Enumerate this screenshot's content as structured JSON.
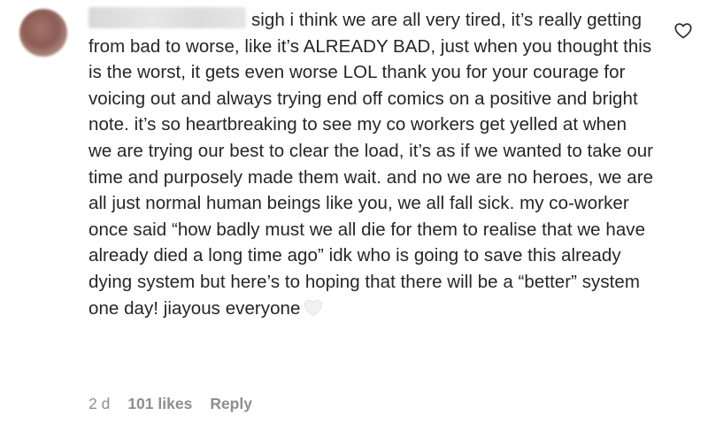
{
  "comment": {
    "text": "sigh i think we are all very tired, it’s really getting from bad to worse, like it’s ALREADY BAD, just when you thought this is the worst, it gets even worse LOL thank you for your courage for voicing out and always trying end off comics on a positive and bright note. it’s so heartbreaking to see my co workers get yelled at when we are trying our best to clear the load, it’s as if we wanted to take our time and purposely made them wait. and no we are no heroes, we are all just normal human beings like you, we all fall sick. my co-worker once said “how badly must we all die for them to realise that we have already died a long time ago” idk who is going to save this already dying system but here’s to hoping that there will be a “better” system one day! jiayous everyone",
    "emoji_icon": "white-heart-icon",
    "time": "2 d",
    "likes": "101 likes",
    "reply_label": "Reply",
    "like_icon": "heart-outline-icon"
  },
  "colors": {
    "text": "#262626",
    "meta": "#8e8e8e",
    "background": "#ffffff"
  }
}
